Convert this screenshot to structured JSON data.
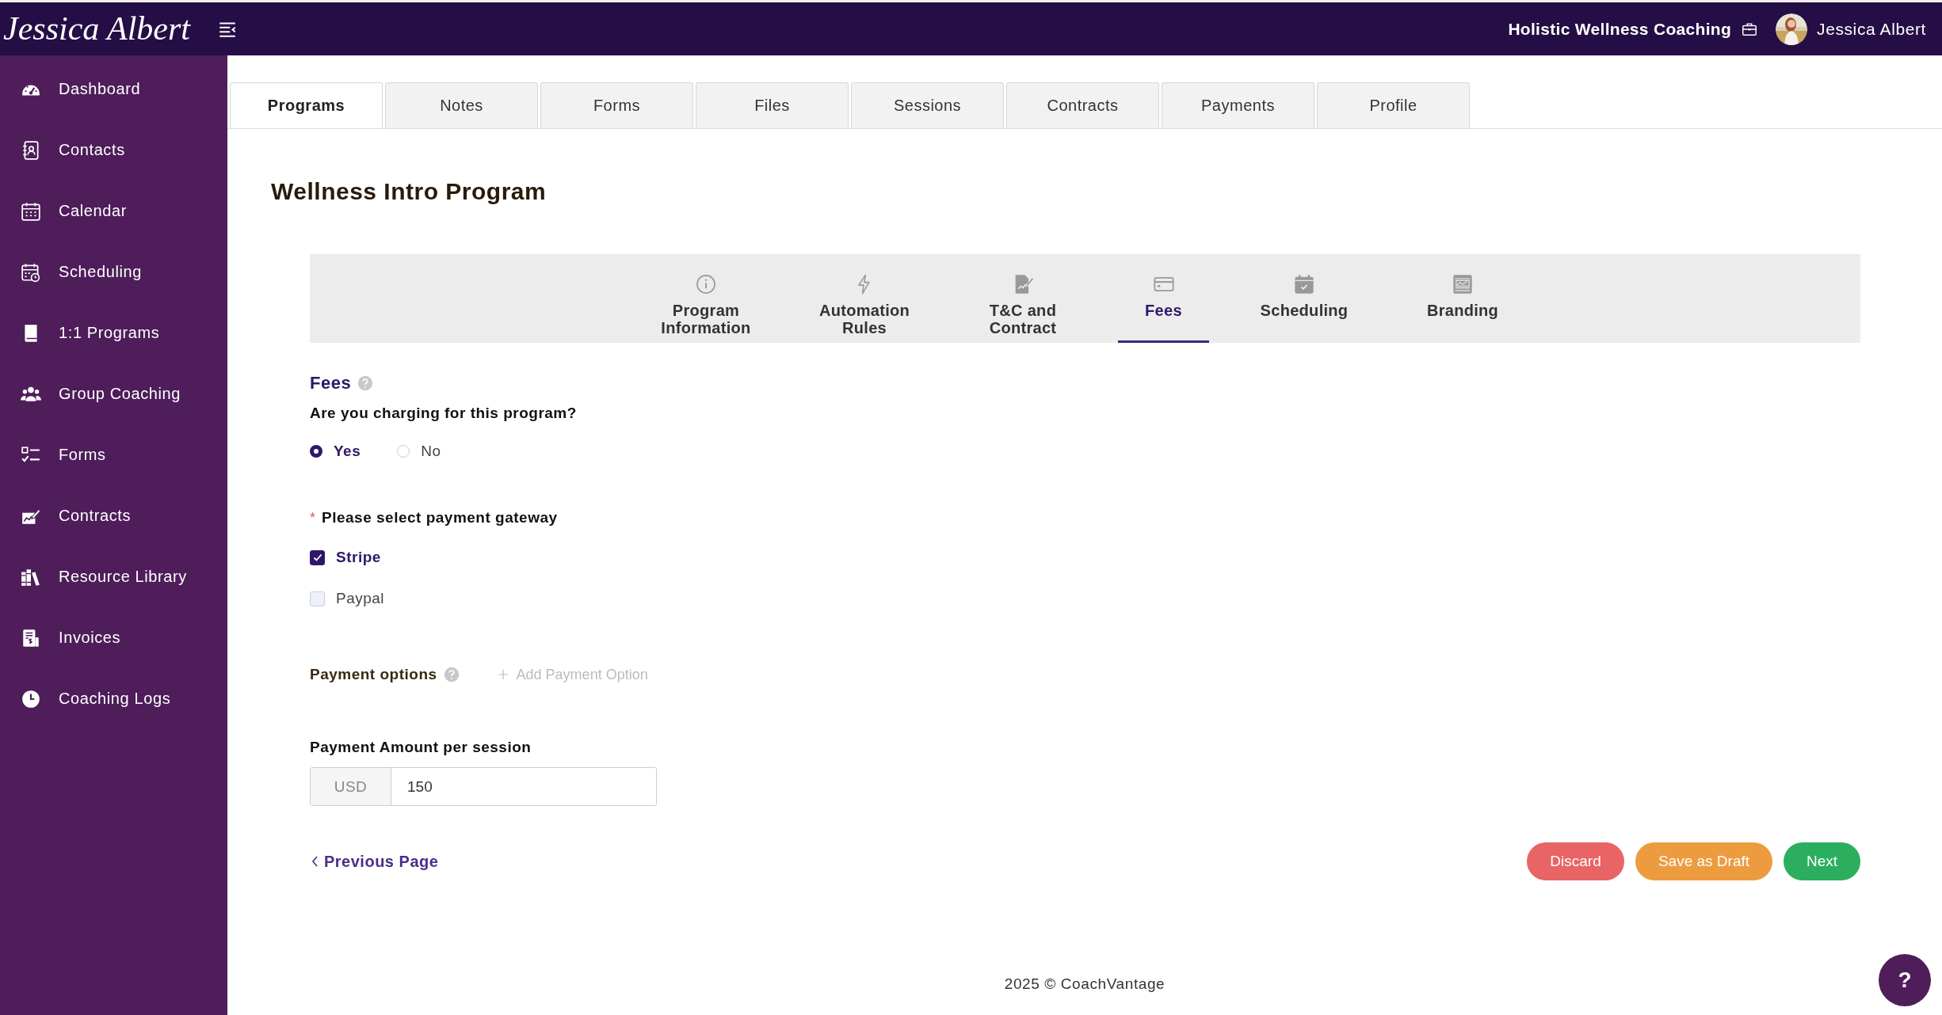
{
  "header": {
    "logo": "Jessica Albert",
    "business": "Holistic Wellness Coaching",
    "user": "Jessica Albert"
  },
  "sidebar": {
    "items": [
      {
        "label": "Dashboard",
        "selected": false
      },
      {
        "label": "Contacts",
        "selected": false
      },
      {
        "label": "Calendar",
        "selected": false
      },
      {
        "label": "Scheduling",
        "selected": false
      },
      {
        "label": "1:1 Programs",
        "selected": false
      },
      {
        "label": "Group Coaching",
        "selected": false
      },
      {
        "label": "Forms",
        "selected": false
      },
      {
        "label": "Contracts",
        "selected": false
      },
      {
        "label": "Resource Library",
        "selected": false
      },
      {
        "label": "Invoices",
        "selected": false
      },
      {
        "label": "Coaching Logs",
        "selected": false
      }
    ]
  },
  "tabs": [
    {
      "label": "Programs",
      "selected": true
    },
    {
      "label": "Notes",
      "selected": false
    },
    {
      "label": "Forms",
      "selected": false
    },
    {
      "label": "Files",
      "selected": false
    },
    {
      "label": "Sessions",
      "selected": false
    },
    {
      "label": "Contracts",
      "selected": false
    },
    {
      "label": "Payments",
      "selected": false
    },
    {
      "label": "Profile",
      "selected": false
    }
  ],
  "title": "Wellness Intro Program",
  "steps": [
    {
      "label": "Program Information",
      "selected": false
    },
    {
      "label": "Automation Rules",
      "selected": false
    },
    {
      "label": "T&C and Contract",
      "selected": false
    },
    {
      "label": "Fees",
      "selected": true
    },
    {
      "label": "Scheduling",
      "selected": false
    },
    {
      "label": "Branding",
      "selected": false
    }
  ],
  "fees": {
    "heading": "Fees",
    "question": "Are you charging for this program?",
    "charging_options": [
      {
        "label": "Yes",
        "selected": true
      },
      {
        "label": "No",
        "selected": false
      }
    ],
    "gateway_required_mark": "*",
    "gateway_label": "Please select payment gateway",
    "gateways": [
      {
        "label": "Stripe",
        "checked": true
      },
      {
        "label": "Paypal",
        "checked": false
      }
    ],
    "payment_options_label": "Payment options",
    "add_payment_option": "Add Payment Option",
    "amount_label": "Payment Amount per session",
    "currency": "USD",
    "amount": "150"
  },
  "previous": "Previous Page",
  "buttons": [
    {
      "label": "Discard",
      "kind": "discard"
    },
    {
      "label": "Save as Draft",
      "kind": "draft"
    },
    {
      "label": "Next",
      "kind": "next"
    }
  ],
  "footer": "2025 © CoachVantage",
  "help_button": "?"
}
